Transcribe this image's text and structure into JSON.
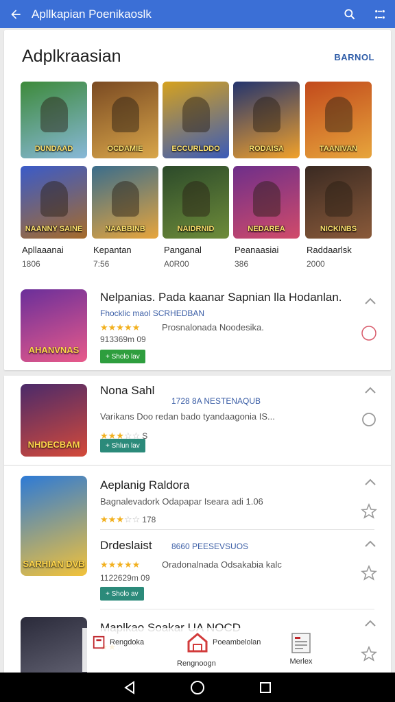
{
  "appbar": {
    "title": "Apllkapian Poenikaoslk",
    "back_icon": "arrow-left-icon",
    "search_icon": "search-icon",
    "menu_icon": "grid-menu-icon"
  },
  "featured": {
    "title": "Adplkraasian",
    "more_label": "BARNOL",
    "tiles": [
      {
        "caption": "DUNDAAD",
        "c1": "#3d8a3a",
        "c2": "#88b8d8"
      },
      {
        "caption": "OCDAMIE",
        "c1": "#7a4a22",
        "c2": "#d9a64a"
      },
      {
        "caption": "ECCURLDDO",
        "c1": "#d6a21e",
        "c2": "#3a5bb8"
      },
      {
        "caption": "RODAISA",
        "c1": "#23346e",
        "c2": "#f1a12b"
      },
      {
        "caption": "TAANIVAN",
        "c1": "#c24a1c",
        "c2": "#e7a53c"
      },
      {
        "caption": "NAANNY SAINE",
        "c1": "#3a5bc9",
        "c2": "#a66b2a"
      },
      {
        "caption": "NAABBINB",
        "c1": "#3a6d8c",
        "c2": "#e7a53c"
      },
      {
        "caption": "NAIDRNID",
        "c1": "#2c4a2a",
        "c2": "#6e8c3a"
      },
      {
        "caption": "NEDAREA",
        "c1": "#6e2f8a",
        "c2": "#d14b6a"
      },
      {
        "caption": "NICKINBS",
        "c1": "#3a2a22",
        "c2": "#8a5a3a"
      }
    ],
    "labels": [
      {
        "name": "Apllaaanai",
        "value": "1806"
      },
      {
        "name": "Kepantan",
        "value": "7:56"
      },
      {
        "name": "Panganal",
        "value": "A0R00"
      },
      {
        "name": "Peanaasiai",
        "value": "386"
      },
      {
        "name": "Raddaarlsk",
        "value": "2000"
      }
    ]
  },
  "list": [
    {
      "title": "Nelpanias. Pada kaanar Sapnian lla Hodanlan.",
      "subtitle": "Fhocklic maol SCRHEDBAN",
      "description": "Prosnalonada Noodesika.",
      "rating": 5,
      "rating_text": "",
      "count": "913369m 09",
      "badge": "+ Sholo lav",
      "badge_color": "#2e9e3e",
      "thumb_caption": "AHANVNAS",
      "thumb_c1": "#6a2f9a",
      "thumb_c2": "#e85a8a"
    },
    {
      "title": "Nona Sahl",
      "subtitle": "1728 8A NESTENAQUB",
      "description": "Varikans Doo redan bado tyandaagonia IS...",
      "rating": 3,
      "rating_text": "S",
      "count": "",
      "badge": "+ Shlun lav",
      "badge_color": "#2b8a7a",
      "thumb_caption": "NHDECBAM",
      "thumb_c1": "#4a2a6a",
      "thumb_c2": "#d44a3a"
    },
    {
      "title": "Aeplanig Raldora",
      "subtitle": "",
      "description": "Bagnalevadork Odapapar Iseara adi 1.06",
      "rating": 3,
      "rating_text": "178",
      "count": "",
      "badge": "",
      "badge_color": "",
      "thumb_caption": "SARHIAN DVB",
      "thumb_c1": "#2d7ad6",
      "thumb_c2": "#f2c23a"
    },
    {
      "title": "Drdeslaist",
      "subtitle": "8660 PEESEVSUOS",
      "description": "Oradonalnada Odsakabia kalc",
      "rating": 5,
      "rating_text": "",
      "count": "1122629m 09",
      "badge": "+ Sholo av",
      "badge_color": "#2b8a7a",
      "thumb_caption": "",
      "thumb_c1": "",
      "thumb_c2": ""
    },
    {
      "title": "Maplkao Soakar UA NOCD",
      "subtitle": "",
      "description": "",
      "rating": 2,
      "rating_text": "",
      "count": "",
      "badge": "",
      "badge_color": "",
      "thumb_caption": "",
      "thumb_c1": "#2a2a3a",
      "thumb_c2": "#6a6a7a"
    }
  ],
  "floatnav": {
    "items": [
      {
        "label": "Rengdoka",
        "icon": "book-icon"
      },
      {
        "label": "Poeambelolan",
        "icon": "home-icon"
      },
      {
        "label": "Rengnoogn",
        "icon": "ranking-icon"
      },
      {
        "label": "Merlex",
        "icon": "document-icon"
      }
    ]
  },
  "system_nav": {
    "back": "back-triangle-icon",
    "home": "home-circle-icon",
    "recents": "recents-square-icon"
  }
}
